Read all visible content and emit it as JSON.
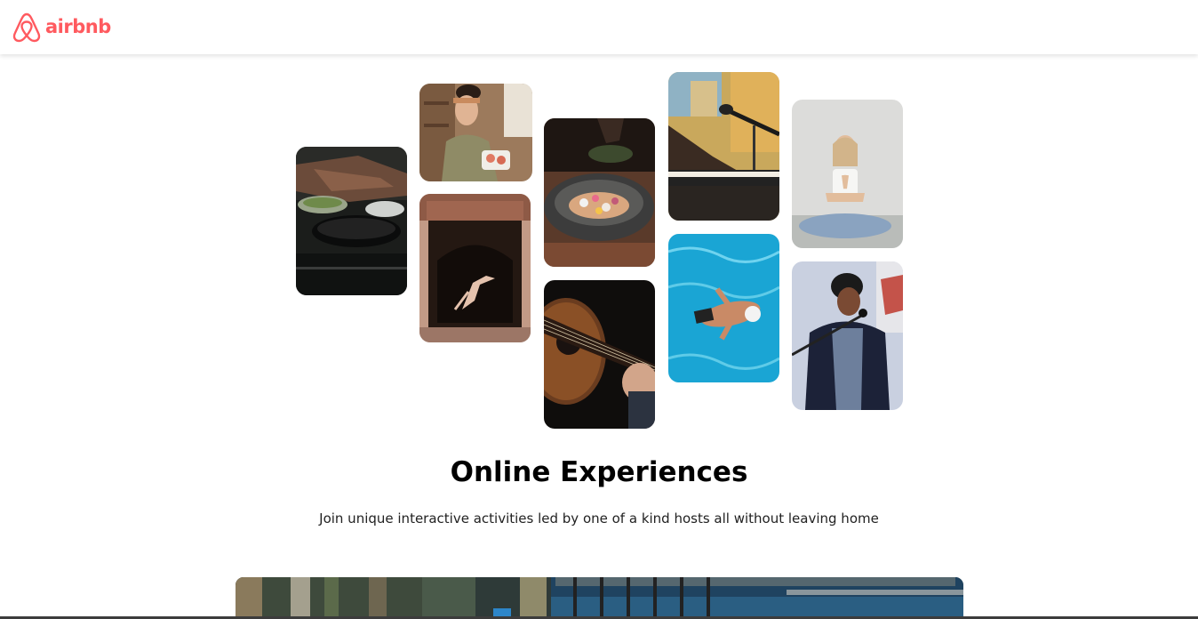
{
  "brand": {
    "name": "airbnb",
    "color": "#FF5A5F"
  },
  "hero": {
    "photos": [
      {
        "subject": "chefs-cooking-photo"
      },
      {
        "subject": "woman-chef-photo"
      },
      {
        "subject": "dancer-doorway-photo"
      },
      {
        "subject": "food-bowl-photo"
      },
      {
        "subject": "guitar-photo"
      },
      {
        "subject": "piano-microphone-photo"
      },
      {
        "subject": "swimmer-photo"
      },
      {
        "subject": "yoga-photo"
      },
      {
        "subject": "singer-photo"
      }
    ]
  },
  "main": {
    "title": "Online Experiences",
    "subtitle": "Join unique interactive activities led by one of a kind hosts all without leaving home"
  },
  "banner": {
    "subject": "resort-pool-photo"
  }
}
